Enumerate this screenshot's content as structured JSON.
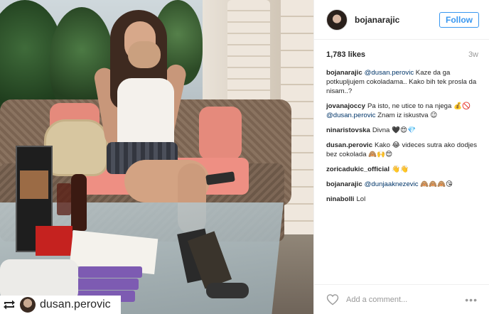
{
  "post": {
    "username": "bojanarajic",
    "follow_label": "Follow",
    "likes": "1,783 likes",
    "time_ago": "3w"
  },
  "repost": {
    "username": "dusan.perovic"
  },
  "comments": [
    {
      "user": "bojanarajic",
      "parts": [
        {
          "type": "mention",
          "text": "@dusan.perovic"
        },
        {
          "type": "text",
          "text": " Kaze da ga potkupljujem cokoladama.. Kako bih tek prosla da nisam..?"
        }
      ]
    },
    {
      "user": "jovanajoccy",
      "parts": [
        {
          "type": "text",
          "text": "Pa isto, ne utice to na njega 💰🚫 "
        },
        {
          "type": "mention",
          "text": "@dusan.perovic"
        },
        {
          "type": "text",
          "text": " Znam iz iskustva 😉"
        }
      ]
    },
    {
      "user": "ninaristovska",
      "parts": [
        {
          "type": "text",
          "text": "Divna 🖤😍💎"
        }
      ]
    },
    {
      "user": "dusan.perovic",
      "parts": [
        {
          "type": "text",
          "text": "Kako 😂 videces sutra ako dodjes bez cokolada 🙈🙌😍"
        }
      ]
    },
    {
      "user": "zoricadukic_official",
      "parts": [
        {
          "type": "text",
          "text": "👋👋"
        }
      ]
    },
    {
      "user": "bojanarajic",
      "parts": [
        {
          "type": "mention",
          "text": "@dunjaaknezevic"
        },
        {
          "type": "text",
          "text": " 🙈🙈🙈😘"
        }
      ]
    },
    {
      "user": "ninabolli",
      "parts": [
        {
          "type": "text",
          "text": "Lol"
        }
      ]
    }
  ],
  "footer": {
    "add_comment_placeholder": "Add a comment...",
    "more_label": "•••"
  },
  "icons": {
    "repost": "repost-icon",
    "heart": "heart-icon",
    "more": "more-options-icon"
  },
  "colors": {
    "follow_blue": "#3897f0",
    "mention": "#003569",
    "muted": "#999999"
  }
}
